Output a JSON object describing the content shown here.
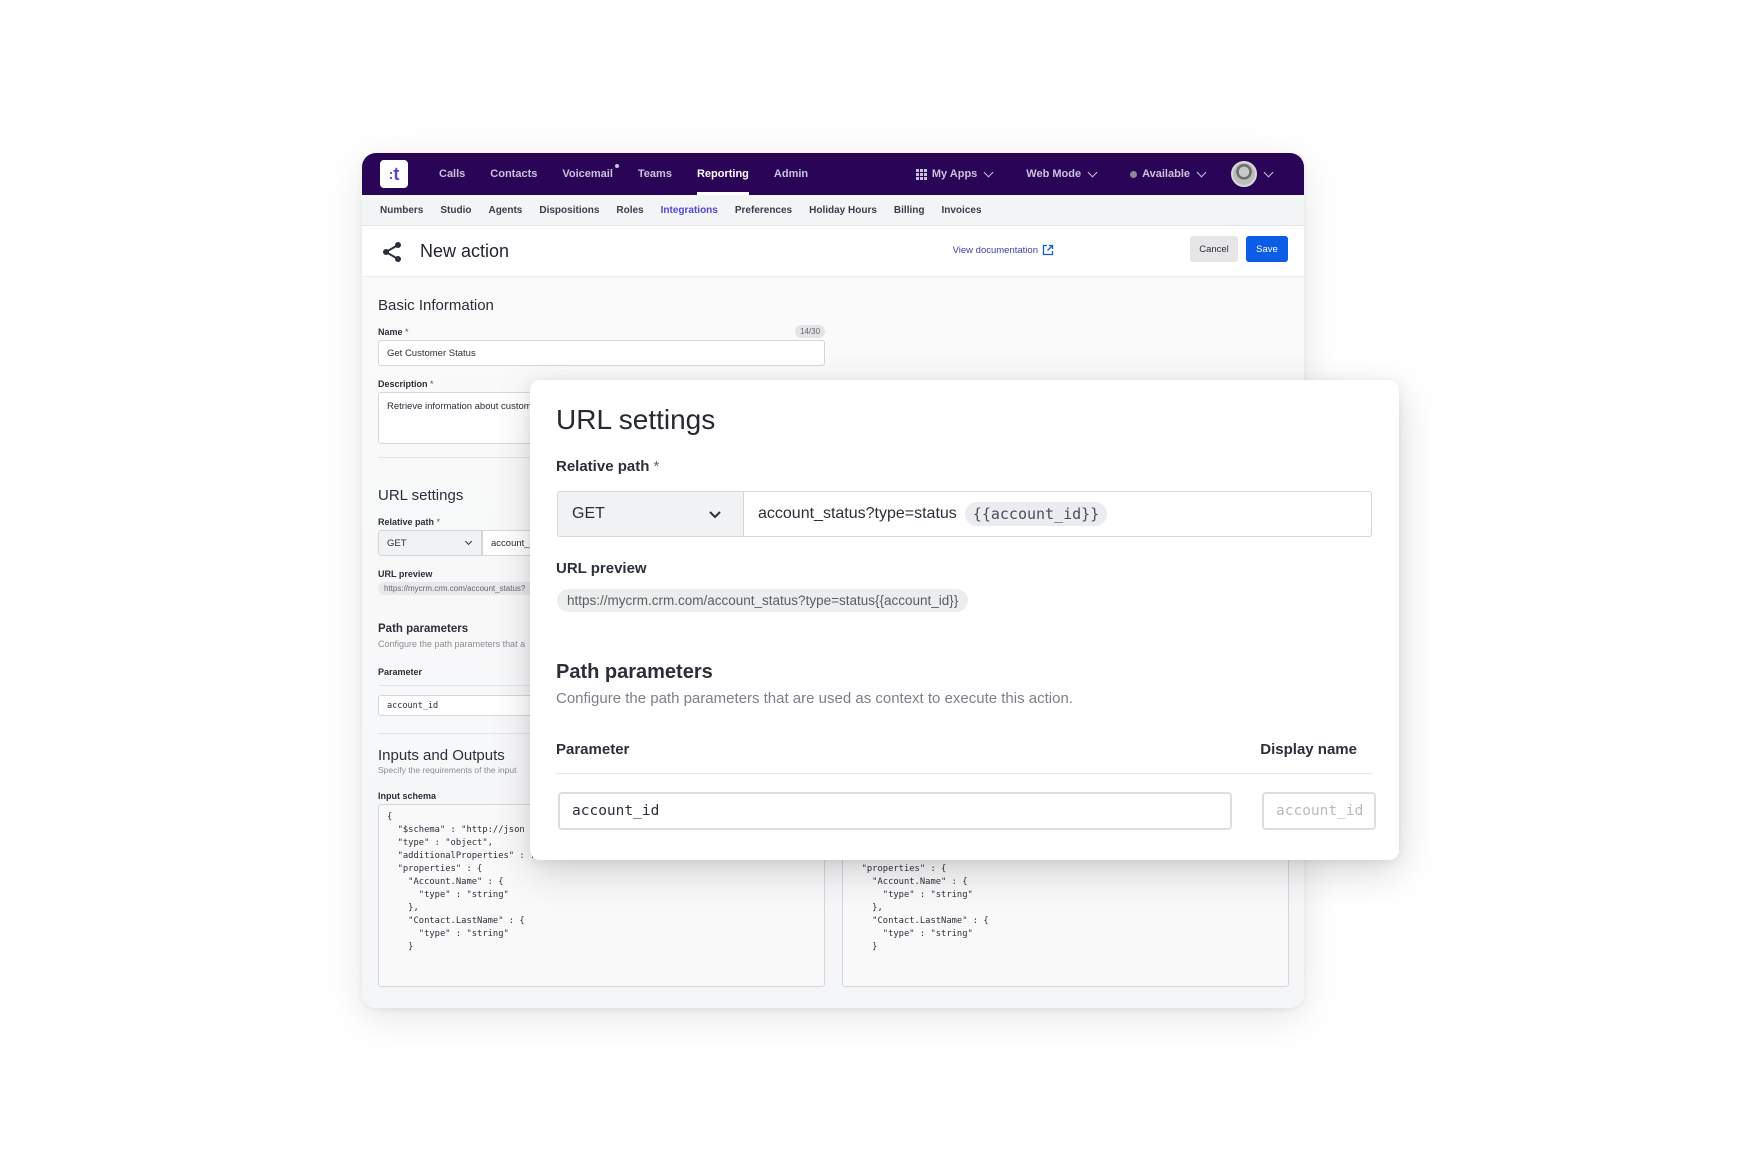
{
  "topnav": {
    "logo_text": "t",
    "items": [
      {
        "label": "Calls",
        "active": false,
        "dot": false
      },
      {
        "label": "Contacts",
        "active": false,
        "dot": false
      },
      {
        "label": "Voicemail",
        "active": false,
        "dot": true
      },
      {
        "label": "Teams",
        "active": false,
        "dot": false
      },
      {
        "label": "Reporting",
        "active": true,
        "dot": false
      },
      {
        "label": "Admin",
        "active": false,
        "dot": false
      }
    ],
    "my_apps": "My Apps",
    "web_mode": "Web Mode",
    "status": "Available",
    "icons": {
      "apps": "grid-icon",
      "status": "status-dot-icon",
      "avatar": "user-avatar"
    }
  },
  "subnav": {
    "items": [
      {
        "label": "Numbers",
        "active": false
      },
      {
        "label": "Studio",
        "active": false
      },
      {
        "label": "Agents",
        "active": false
      },
      {
        "label": "Dispositions",
        "active": false
      },
      {
        "label": "Roles",
        "active": false
      },
      {
        "label": "Integrations",
        "active": true
      },
      {
        "label": "Preferences",
        "active": false
      },
      {
        "label": "Holiday Hours",
        "active": false
      },
      {
        "label": "Billing",
        "active": false
      },
      {
        "label": "Invoices",
        "active": false
      }
    ]
  },
  "header": {
    "title": "New action",
    "view_docs": "View documentation",
    "cancel": "Cancel",
    "save": "Save",
    "icons": {
      "title": "share-icon",
      "docs": "external-link-icon"
    }
  },
  "basic": {
    "title": "Basic Information",
    "name_label": "Name",
    "required_mark": "*",
    "name_counter": "14/30",
    "name_value": "Get Customer Status",
    "description_label": "Description",
    "description_value": "Retrieve information about custome"
  },
  "url_bg": {
    "title": "URL settings",
    "relative_path_label": "Relative path",
    "method": "GET",
    "path_value": "account_s",
    "preview_label": "URL preview",
    "preview_value": "https://mycrm.crm.com/account_status?"
  },
  "path_bg": {
    "title": "Path parameters",
    "subtitle": "Configure the path parameters that a",
    "parameter_label": "Parameter",
    "parameter_value": "account_id"
  },
  "io": {
    "title": "Inputs and Outputs",
    "subtitle": "Specify the requirements of the input",
    "input_schema_label": "Input schema",
    "input_schema": "{\n  \"$schema\" : \"http://json\n  \"type\" : \"object\",\n  \"additionalProperties\" : false,\n  \"properties\" : {\n    \"Account.Name\" : {\n      \"type\" : \"string\"\n    },\n    \"Contact.LastName\" : {\n      \"type\" : \"string\"\n    }",
    "output_schema": "  \"type\" : \"object\",\n  \"additionalProperties\" : false,\n  \"properties\" : {\n    \"Account.Name\" : {\n      \"type\" : \"string\"\n    },\n    \"Contact.LastName\" : {\n      \"type\" : \"string\"\n    }"
  },
  "modal": {
    "title": "URL settings",
    "relative_path_label": "Relative path",
    "required_mark": "*",
    "method": "GET",
    "path_text": "account_status?type=status",
    "path_token": "{{account_id}}",
    "preview_label": "URL preview",
    "preview_value": "https://mycrm.crm.com/account_status?type=status{{account_id}}",
    "path_params_title": "Path parameters",
    "path_params_subtitle": "Configure the path parameters that are used as context to execute this action.",
    "col_parameter": "Parameter",
    "col_display_name": "Display name",
    "parameter_value": "account_id",
    "display_name_placeholder": "account_id"
  },
  "colors": {
    "nav_bg": "#2a0457",
    "accent": "#5146d6",
    "primary_button": "#0b5ce6"
  }
}
